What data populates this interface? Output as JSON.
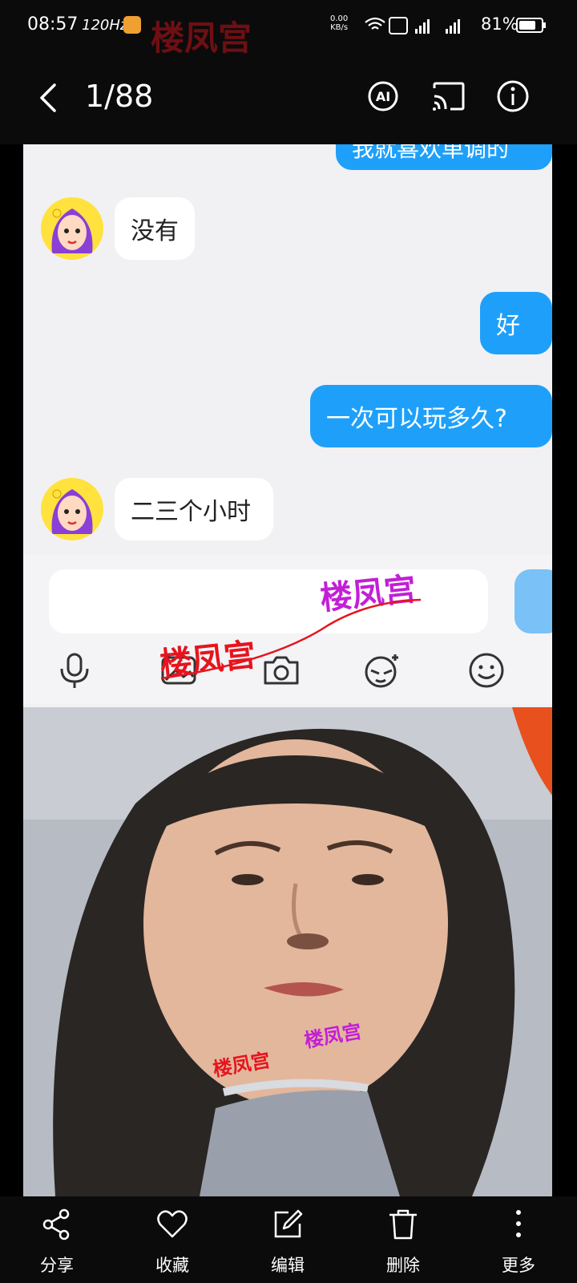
{
  "status": {
    "time": "08:57",
    "refresh": "120Hz",
    "speed_value": "0.00",
    "speed_unit": "KB/s",
    "battery": "81%"
  },
  "header": {
    "counter": "1/88",
    "icons": [
      "back-icon",
      "ai-icon",
      "cast-icon",
      "info-icon"
    ]
  },
  "chat": {
    "top_partial": "我就喜欢单调的",
    "messages": [
      {
        "side": "other",
        "text": "没有"
      },
      {
        "side": "me",
        "text": "好"
      },
      {
        "side": "me",
        "text": "一次可以玩多久?"
      },
      {
        "side": "other",
        "text": "二三个小时"
      }
    ],
    "toolbar_icons": [
      "microphone-icon",
      "image-icon",
      "camera-icon",
      "sticker-icon",
      "emoji-icon"
    ]
  },
  "watermark": {
    "text": "楼凤宫",
    "colors": {
      "red": "#e6141e",
      "pink": "#c21fd6"
    }
  },
  "actions": [
    {
      "icon": "share-icon",
      "label": "分享"
    },
    {
      "icon": "heart-icon",
      "label": "收藏"
    },
    {
      "icon": "edit-icon",
      "label": "编辑"
    },
    {
      "icon": "trash-icon",
      "label": "删除"
    },
    {
      "icon": "more-icon",
      "label": "更多"
    }
  ],
  "colors": {
    "accent_bubble": "#1ea0fa",
    "background": "#0b0b0b"
  }
}
